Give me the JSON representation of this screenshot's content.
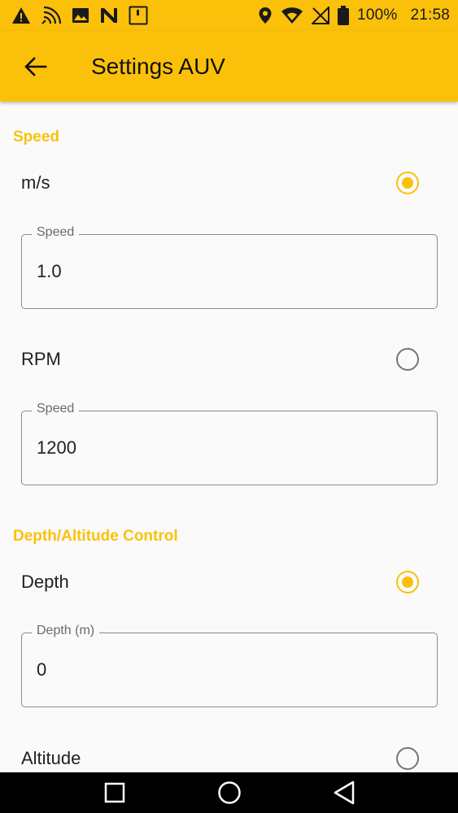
{
  "status_bar": {
    "battery": "100%",
    "time": "21:58",
    "icons_left": [
      "warning-icon",
      "wifi-calling-icon",
      "image-icon",
      "n-icon",
      "sim-icon"
    ],
    "icons_right": [
      "location-icon",
      "wifi-icon",
      "no-signal-icon",
      "battery-icon"
    ]
  },
  "app_bar": {
    "title": "Settings AUV",
    "back_icon": "arrow-back-icon"
  },
  "speed_section": {
    "header": "Speed",
    "ms_option": {
      "label": "m/s",
      "selected": true
    },
    "ms_field": {
      "legend": "Speed",
      "value": "1.0"
    },
    "rpm_option": {
      "label": "RPM",
      "selected": false
    },
    "rpm_field": {
      "legend": "Speed",
      "value": "1200"
    }
  },
  "depth_section": {
    "header": "Depth/Altitude Control",
    "depth_option": {
      "label": "Depth",
      "selected": true
    },
    "depth_field": {
      "legend": "Depth (m)",
      "value": "0"
    },
    "altitude_option": {
      "label": "Altitude",
      "selected": false
    }
  },
  "nav_bar": {
    "icons": [
      "recents-icon",
      "home-icon",
      "back-icon"
    ]
  },
  "colors": {
    "accent": "#fbc10a",
    "background": "#fafafa",
    "text": "#1f1f1f"
  }
}
